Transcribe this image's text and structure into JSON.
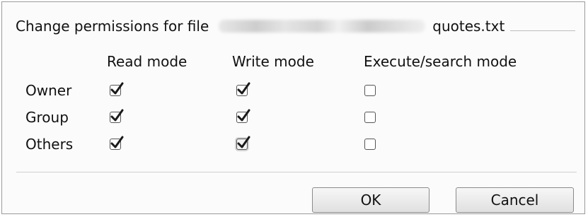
{
  "dialog": {
    "title_prefix": "Change permissions for file",
    "filename": "quotes.txt"
  },
  "columns": [
    "Read mode",
    "Write mode",
    "Execute/search mode"
  ],
  "rows": [
    {
      "label": "Owner",
      "read": true,
      "write": true,
      "execute": false
    },
    {
      "label": "Group",
      "read": true,
      "write": true,
      "execute": false
    },
    {
      "label": "Others",
      "read": true,
      "write": true,
      "execute": false
    }
  ],
  "buttons": {
    "ok": "OK",
    "cancel": "Cancel"
  }
}
